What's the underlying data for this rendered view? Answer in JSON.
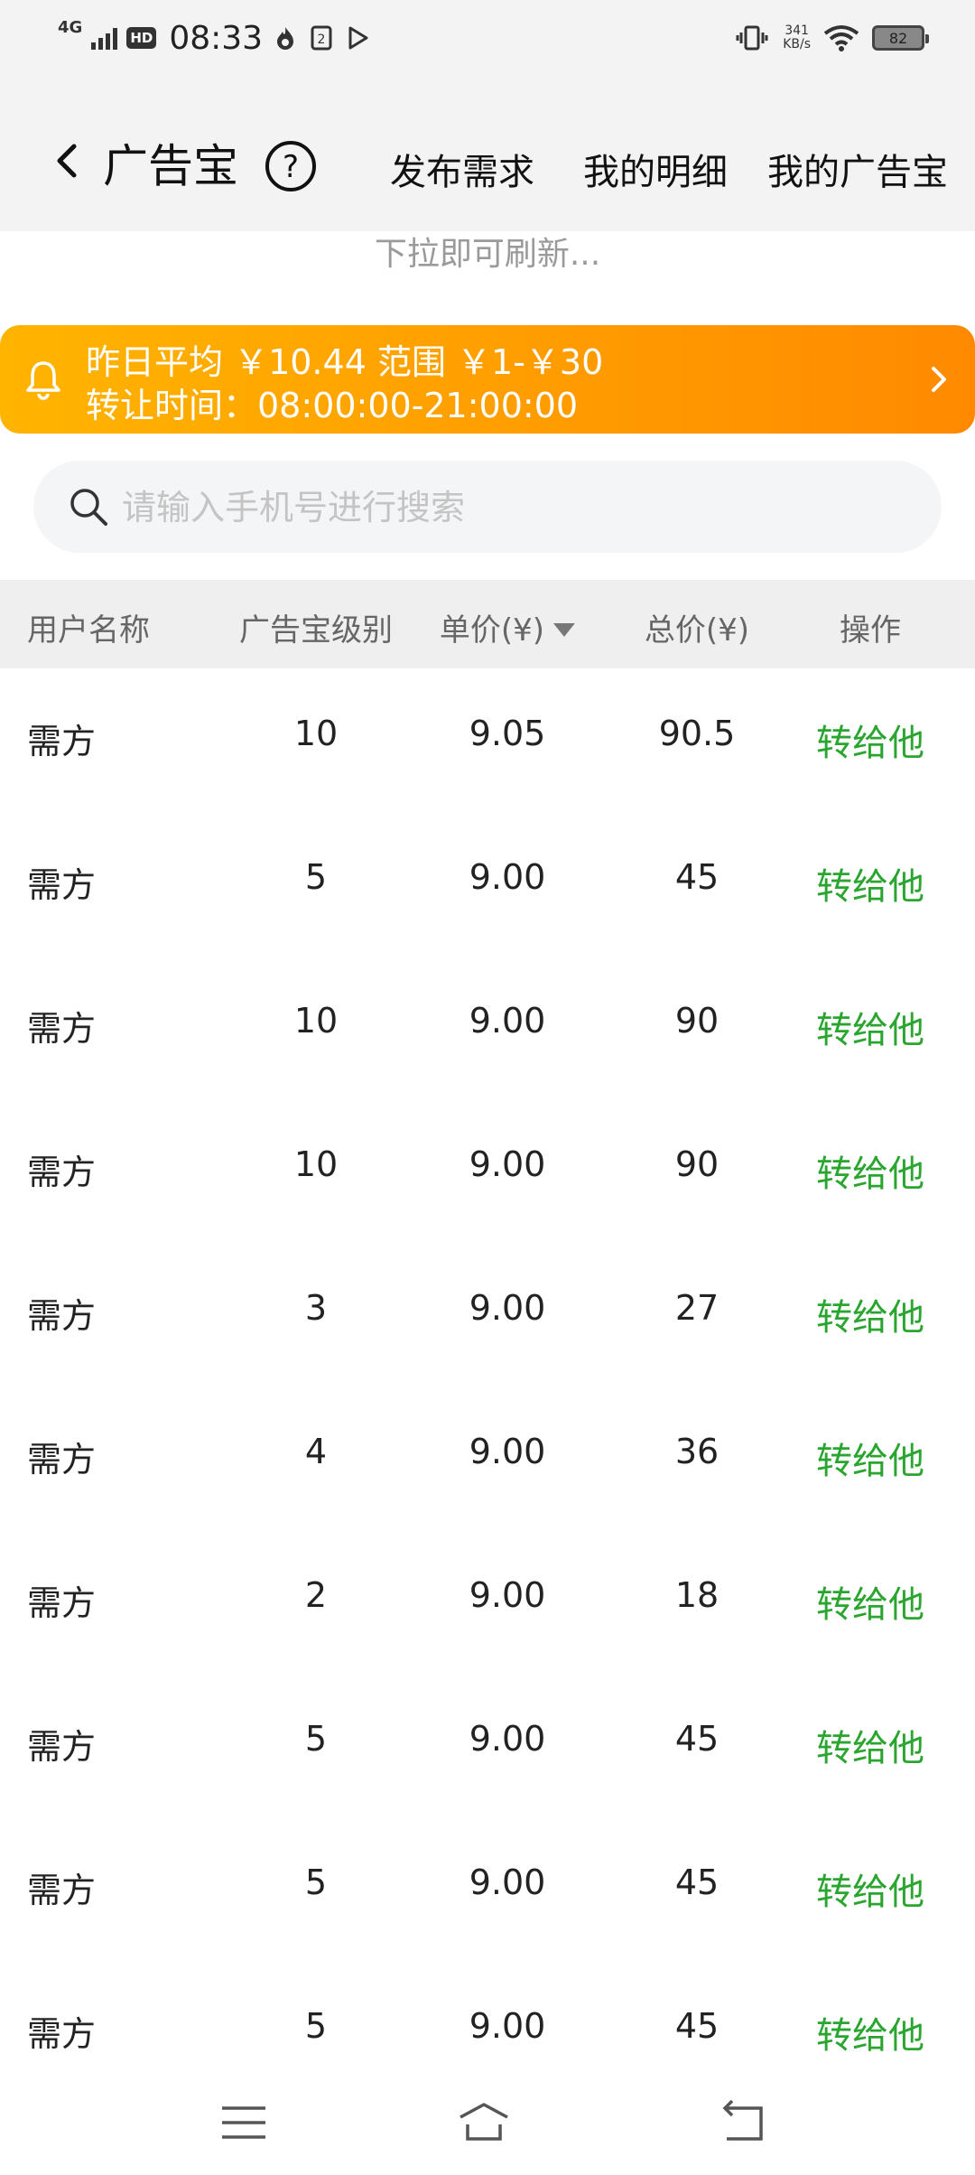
{
  "status_bar": {
    "network": "4G",
    "hd": "HD",
    "time": "08:33",
    "speed_value": "341",
    "speed_unit": "KB/s",
    "battery": "82"
  },
  "nav": {
    "title": "广告宝",
    "links": [
      "发布需求",
      "我的明细",
      "我的广告宝"
    ]
  },
  "refresh_hint": "下拉即可刷新...",
  "banner": {
    "line1": "昨日平均 ￥10.44  范围 ￥1-￥30",
    "line2": "转让时间：08:00:00-21:00:00"
  },
  "search": {
    "placeholder": "请输入手机号进行搜索",
    "value": ""
  },
  "table": {
    "headers": [
      "用户名称",
      "广告宝级别",
      "单价(¥)",
      "总价(¥)",
      "操作"
    ],
    "rows": [
      {
        "user": "需方",
        "level": "10",
        "price": "9.05",
        "total": "90.5",
        "action": "转给他"
      },
      {
        "user": "需方",
        "level": "5",
        "price": "9.00",
        "total": "45",
        "action": "转给他"
      },
      {
        "user": "需方",
        "level": "10",
        "price": "9.00",
        "total": "90",
        "action": "转给他"
      },
      {
        "user": "需方",
        "level": "10",
        "price": "9.00",
        "total": "90",
        "action": "转给他"
      },
      {
        "user": "需方",
        "level": "3",
        "price": "9.00",
        "total": "27",
        "action": "转给他"
      },
      {
        "user": "需方",
        "level": "4",
        "price": "9.00",
        "total": "36",
        "action": "转给他"
      },
      {
        "user": "需方",
        "level": "2",
        "price": "9.00",
        "total": "18",
        "action": "转给他"
      },
      {
        "user": "需方",
        "level": "5",
        "price": "9.00",
        "total": "45",
        "action": "转给他"
      },
      {
        "user": "需方",
        "level": "5",
        "price": "9.00",
        "total": "45",
        "action": "转给他"
      },
      {
        "user": "需方",
        "level": "5",
        "price": "9.00",
        "total": "45",
        "action": "转给他"
      }
    ]
  },
  "colors": {
    "accent_green": "#2aa52f",
    "banner_start": "#ffb400",
    "banner_end": "#ff8a00"
  },
  "icons": [
    "back-icon",
    "help-icon",
    "bell-icon",
    "chevron-right-icon",
    "search-icon",
    "menu-icon",
    "home-icon",
    "return-icon"
  ]
}
